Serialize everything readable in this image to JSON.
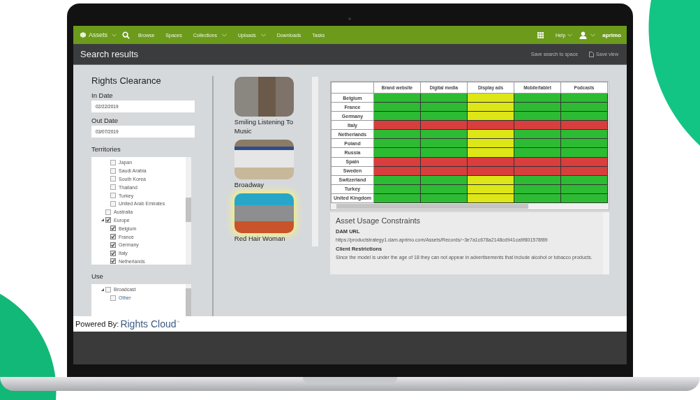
{
  "nav": {
    "app": "Assets",
    "items": [
      {
        "label": "Browse",
        "dropdown": false
      },
      {
        "label": "Spaces",
        "dropdown": false
      },
      {
        "label": "Collections",
        "dropdown": true
      },
      {
        "label": "Uploads",
        "dropdown": true
      },
      {
        "label": "Downloads",
        "dropdown": false
      },
      {
        "label": "Tasks",
        "dropdown": false
      }
    ],
    "help": "Help",
    "logo": "aprimo"
  },
  "header": {
    "title": "Search results",
    "save_search": "Save search to space",
    "save_view": "Save view"
  },
  "filters": {
    "title": "Rights Clearance",
    "in_date": {
      "label": "In Date",
      "value": "02/22/2019"
    },
    "out_date": {
      "label": "Out Date",
      "value": "03/07/2019"
    },
    "territories": {
      "label": "Territories",
      "items": [
        {
          "children": [
            {
              "label": "Japan",
              "checked": false
            },
            {
              "label": "Saudi Arabia",
              "checked": false
            },
            {
              "label": "South Korea",
              "checked": false
            },
            {
              "label": "Thailand",
              "checked": false
            },
            {
              "label": "Turkey",
              "checked": false
            },
            {
              "label": "United Arab Emirates",
              "checked": false
            }
          ]
        },
        {
          "label": "Australia",
          "checked": false
        },
        {
          "label": "Europe",
          "checked": true,
          "expanded": true,
          "children": [
            {
              "label": "Belgium",
              "checked": true
            },
            {
              "label": "France",
              "checked": true
            },
            {
              "label": "Germany",
              "checked": true
            },
            {
              "label": "Italy",
              "checked": true
            },
            {
              "label": "Netherlands",
              "checked": true
            }
          ]
        }
      ]
    },
    "use": {
      "label": "Use",
      "items": [
        {
          "label": "Broadcast",
          "checked": false,
          "expanded": true,
          "children": [
            {
              "label": "Other",
              "checked": false
            }
          ]
        }
      ]
    }
  },
  "assets": [
    {
      "title": "Smiling Listening To Music",
      "selected": false
    },
    {
      "title": "Broadway",
      "selected": false
    },
    {
      "title": "Red Hair Woman",
      "selected": true
    }
  ],
  "matrix": {
    "columns": [
      "Brand website",
      "Digital media",
      "Display ads",
      "Mobile/tablet",
      "Podcasts"
    ],
    "rows": [
      {
        "territory": "Belgium",
        "cells": [
          {
            "color": "#2dbb33"
          },
          {
            "color": "#2dbb33"
          },
          {
            "color": "#dde616"
          },
          {
            "color": "#2dbb33"
          },
          {
            "color": "#2dbb33"
          }
        ]
      },
      {
        "territory": "France",
        "cells": [
          {
            "color": "#2dbb33"
          },
          {
            "color": "#2dbb33"
          },
          {
            "color": "#dde616"
          },
          {
            "color": "#2dbb33"
          },
          {
            "color": "#2dbb33"
          }
        ]
      },
      {
        "territory": "Germany",
        "cells": [
          {
            "color": "#2dbb33"
          },
          {
            "color": "#2dbb33"
          },
          {
            "color": "#dde616"
          },
          {
            "color": "#2dbb33"
          },
          {
            "color": "#2dbb33"
          }
        ]
      },
      {
        "territory": "Italy",
        "cells": [
          {
            "color": "#d93e3e"
          },
          {
            "color": "#d93e3e"
          },
          {
            "color": "#d93e3e"
          },
          {
            "color": "#d93e3e"
          },
          {
            "color": "#d93e3e"
          }
        ]
      },
      {
        "territory": "Netherlands",
        "cells": [
          {
            "color": "#2dbb33"
          },
          {
            "color": "#2dbb33"
          },
          {
            "color": "#dde616"
          },
          {
            "color": "#2dbb33"
          },
          {
            "color": "#2dbb33"
          }
        ]
      },
      {
        "territory": "Poland",
        "cells": [
          {
            "color": "#2dbb33"
          },
          {
            "color": "#2dbb33"
          },
          {
            "color": "#dde616"
          },
          {
            "color": "#2dbb33"
          },
          {
            "color": "#2dbb33"
          }
        ]
      },
      {
        "territory": "Russia",
        "cells": [
          {
            "color": "#2dbb33"
          },
          {
            "color": "#2dbb33"
          },
          {
            "color": "#dde616"
          },
          {
            "color": "#2dbb33"
          },
          {
            "color": "#2dbb33"
          }
        ]
      },
      {
        "territory": "Spain",
        "cells": [
          {
            "color": "#d93e3e"
          },
          {
            "color": "#d93e3e"
          },
          {
            "color": "#d93e3e"
          },
          {
            "color": "#d93e3e"
          },
          {
            "color": "#d93e3e"
          }
        ]
      },
      {
        "territory": "Sweden",
        "cells": [
          {
            "color": "#d93e3e"
          },
          {
            "color": "#d93e3e"
          },
          {
            "color": "#d93e3e"
          },
          {
            "color": "#d93e3e"
          },
          {
            "color": "#d93e3e"
          }
        ]
      },
      {
        "territory": "Switzerland",
        "cells": [
          {
            "color": "#2dbb33"
          },
          {
            "color": "#2dbb33"
          },
          {
            "color": "#dde616"
          },
          {
            "color": "#2dbb33"
          },
          {
            "color": "#2dbb33"
          }
        ]
      },
      {
        "territory": "Turkey",
        "cells": [
          {
            "color": "#2dbb33"
          },
          {
            "color": "#2dbb33"
          },
          {
            "color": "#dde616"
          },
          {
            "color": "#2dbb33"
          },
          {
            "color": "#2dbb33"
          }
        ]
      },
      {
        "territory": "United Kingdom",
        "cells": [
          {
            "color": "#2dbb33"
          },
          {
            "color": "#2dbb33"
          },
          {
            "color": "#dde616"
          },
          {
            "color": "#2dbb33"
          },
          {
            "color": "#2dbb33"
          }
        ]
      }
    ]
  },
  "constraints": {
    "title": "Asset Usage Constraints",
    "sections": [
      {
        "heading": "DAM URL",
        "text": "https://productstrategy1.dam.aprimo.com/Assets/Records/~3e7a1c678a2148cd941ca9f801578f89"
      },
      {
        "heading": "Client Restrictions",
        "text": "Since the model is under the age of 18 they can not appear in advertisements that include alcohol or tobacco products."
      }
    ]
  },
  "footer": {
    "prefix": "Powered By:",
    "brand": "Rights Cloud",
    "mark": "™"
  }
}
